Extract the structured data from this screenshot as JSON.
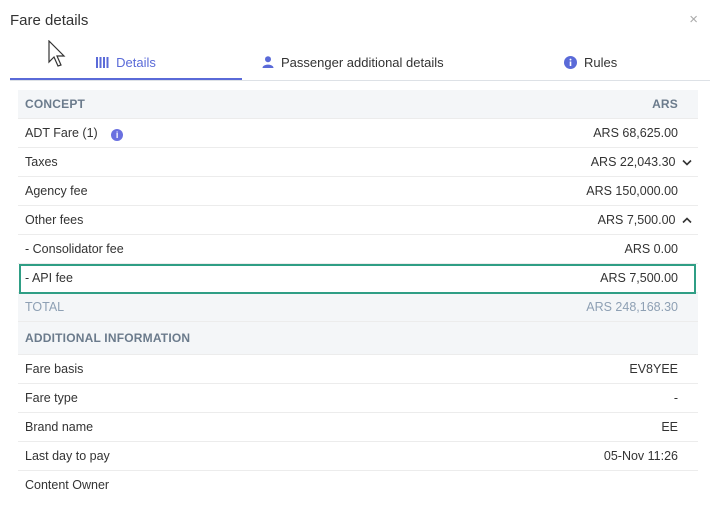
{
  "dialog": {
    "title": "Fare details",
    "close_label": "×"
  },
  "tabs": [
    {
      "label": "Details",
      "icon": "bars-icon",
      "active": true
    },
    {
      "label": "Passenger additional details",
      "icon": "person-icon",
      "active": false
    },
    {
      "label": "Rules",
      "icon": "info-icon",
      "active": false
    }
  ],
  "fare_table": {
    "header": {
      "concept": "CONCEPT",
      "currency": "ARS"
    },
    "rows": [
      {
        "label": "ADT Fare (1)",
        "value": "ARS 68,625.00"
      },
      {
        "label": "Taxes",
        "value": "ARS 22,043.30"
      },
      {
        "label": "Agency fee",
        "value": "ARS 150,000.00"
      },
      {
        "label": "Other fees",
        "value": "ARS 7,500.00"
      },
      {
        "label": "- Consolidator fee",
        "value": "ARS 0.00"
      },
      {
        "label": "- API fee",
        "value": "ARS 7,500.00"
      }
    ],
    "total": {
      "label": "TOTAL",
      "value": "ARS 248,168.30"
    }
  },
  "additional_info": {
    "title": "ADDITIONAL INFORMATION",
    "rows": [
      {
        "label": "Fare basis",
        "value": "EV8YEE"
      },
      {
        "label": "Fare type",
        "value": "-"
      },
      {
        "label": "Brand name",
        "value": "EE"
      },
      {
        "label": "Last day to pay",
        "value": "05-Nov 11:26"
      },
      {
        "label": "Content Owner",
        "value": ""
      }
    ]
  },
  "colors": {
    "accent": "#5a6ad8",
    "highlight": "#2f9e85",
    "header_bg": "#f4f6f8",
    "muted": "#8ea0b4"
  }
}
